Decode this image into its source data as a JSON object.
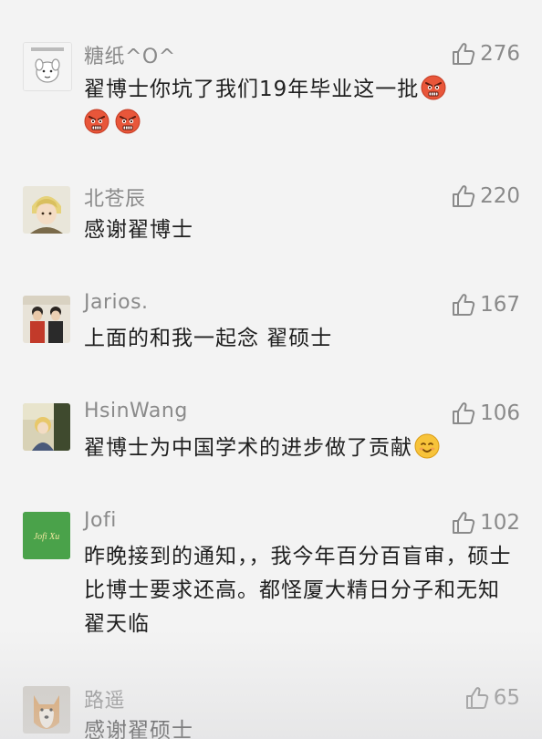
{
  "comments": [
    {
      "username": "糖纸^O^",
      "likes": "276",
      "text": "翟博士你坑了我们19年毕业这一批",
      "emojis": [
        "angry-face-icon",
        "angry-face-icon",
        "angry-face-icon"
      ],
      "avatar": "avatar-dog-sticker"
    },
    {
      "username": "北苍辰",
      "likes": "220",
      "text": "感谢翟博士",
      "avatar": "avatar-anime-character"
    },
    {
      "username": "Jarios.",
      "likes": "167",
      "text": "上面的和我一起念 翟硕士",
      "avatar": "avatar-couple-photo"
    },
    {
      "username": "HsinWang",
      "likes": "106",
      "text": "翟博士为中国学术的进步做了贡献",
      "emojis": [
        "smiling-face-icon"
      ],
      "avatar": "avatar-anime-scene"
    },
    {
      "username": "Jofi",
      "likes": "102",
      "text": "昨晚接到的通知，，我今年百分百盲审，硕士比博士要求还高。都怪厦大精日分子和无知翟天临",
      "avatar": "avatar-jofi-xu",
      "avatar_text": "Jofi Xu"
    },
    {
      "username": "路遥",
      "likes": "65",
      "text": "感谢翟硕士",
      "avatar": "avatar-shiba-dog"
    }
  ],
  "colors": {
    "background": "#f3f3f3",
    "meta_text": "#8a8a8a",
    "body_text": "#202020",
    "jofi_avatar_bg": "#4aa24a"
  }
}
